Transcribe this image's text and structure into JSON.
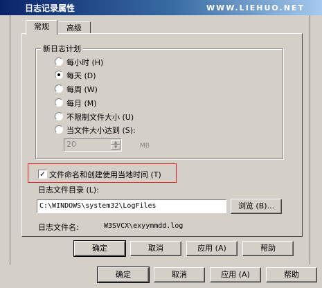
{
  "window": {
    "title": "日志记录属性",
    "watermark": "WWW.LIEHUO.NET"
  },
  "tabs": [
    {
      "label": "常规",
      "active": true
    },
    {
      "label": "高级",
      "active": false
    }
  ],
  "schedule": {
    "group_title": "新日志计划",
    "options": [
      {
        "label": "每小时 (H)",
        "selected": false
      },
      {
        "label": "每天 (D)",
        "selected": true
      },
      {
        "label": "每周 (W)",
        "selected": false
      },
      {
        "label": "每月 (M)",
        "selected": false
      },
      {
        "label": "不限制文件大小 (U)",
        "selected": false
      },
      {
        "label": "当文件大小达到 (S):",
        "selected": false
      }
    ],
    "size_value": "20",
    "size_unit": "MB"
  },
  "local_time": {
    "label": "文件命名和创建使用当地时间 (T)",
    "checked": true
  },
  "log_dir": {
    "label": "日志文件目录 (L):",
    "value": "C:\\WINDOWS\\system32\\LogFiles",
    "browse_label": "浏览 (B)..."
  },
  "log_name": {
    "label": "日志文件名:",
    "value": "W3SVCX\\exyymmdd.log"
  },
  "inner_buttons": {
    "ok": "确定",
    "cancel": "取消",
    "apply": "应用 (A)",
    "help": "帮助"
  },
  "outer_buttons": {
    "ok": "确定",
    "cancel": "取消",
    "apply": "应用 (A)",
    "help": "帮助"
  },
  "icons": {
    "checkbox": "check-mark",
    "spin_up": "up-arrow",
    "spin_down": "down-arrow"
  }
}
